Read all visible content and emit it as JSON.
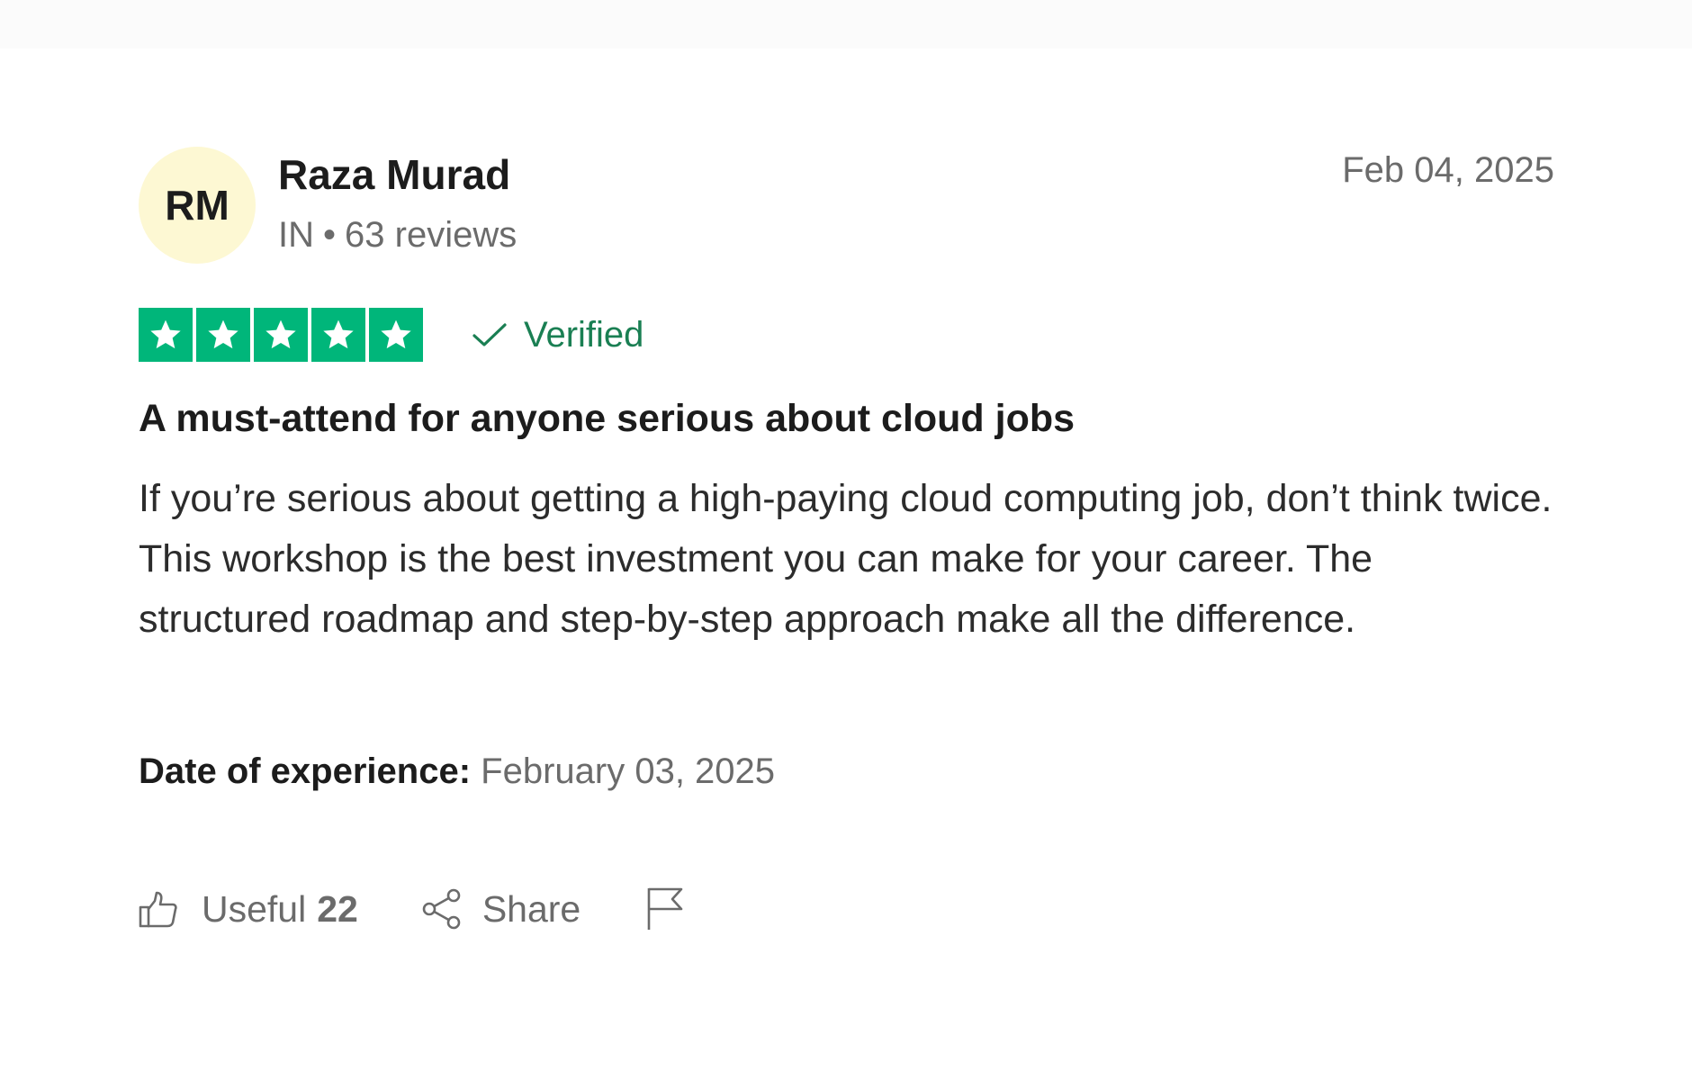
{
  "reviewer": {
    "initials": "RM",
    "name": "Raza Murad",
    "country": "IN",
    "separator": "•",
    "reviews": "63 reviews",
    "avatar_color": "#fdf8d3"
  },
  "review": {
    "date": "Feb 04, 2025",
    "rating": 5,
    "rating_max": 5,
    "star_color": "#00b67a",
    "verified_label": "Verified",
    "verified_color": "#1a7f53",
    "title": "A must-attend for anyone serious about cloud jobs",
    "body": "If you’re serious about getting a high-paying cloud computing job, don’t think twice. This workshop is the best investment you can make for your career. The structured roadmap and step-by-step approach make all the difference.",
    "experience_label": "Date of experience:",
    "experience_date": "February 03, 2025"
  },
  "actions": {
    "useful_label": "Useful",
    "useful_count": "22",
    "share_label": "Share",
    "icons": [
      "thumbs-up-icon",
      "share-icon",
      "flag-icon"
    ]
  }
}
